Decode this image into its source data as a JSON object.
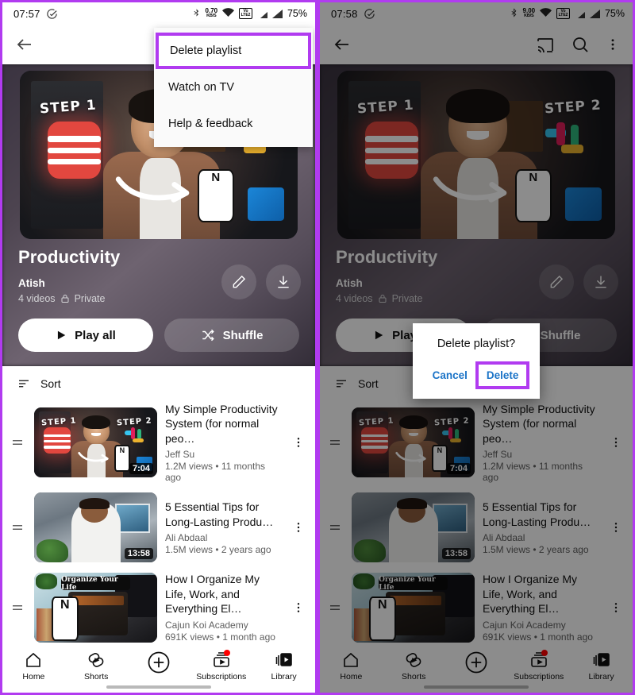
{
  "panels": [
    {
      "id": "left",
      "status_bar": {
        "time": "07:57",
        "check_icon": "check-circle-icon",
        "bluetooth_icon": "bluetooth-icon",
        "data_rate": "0.70",
        "data_unit": "KB/S",
        "wifi_icon": "wifi-icon",
        "volte_label_top": "Vo",
        "volte_label_bottom": "LTE2",
        "signal_icon": "signal-bars-icon",
        "battery": "75%"
      },
      "app_bar": {
        "back_icon": "back-arrow-icon",
        "cast_icon": "cast-icon",
        "search_icon": "search-icon",
        "overflow_icon": "more-vertical-icon"
      },
      "overflow_menu": {
        "visible": true,
        "items": [
          {
            "label": "Delete playlist",
            "highlighted": true
          },
          {
            "label": "Watch on TV",
            "highlighted": false
          },
          {
            "label": "Help & feedback",
            "highlighted": false
          }
        ]
      },
      "dialog": {
        "visible": false
      },
      "dimmed": false
    },
    {
      "id": "right",
      "status_bar": {
        "time": "07:58",
        "check_icon": "check-circle-icon",
        "bluetooth_icon": "bluetooth-icon",
        "data_rate": "9.00",
        "data_unit": "KB/S",
        "wifi_icon": "wifi-icon",
        "volte_label_top": "Vo",
        "volte_label_bottom": "LTE2",
        "signal_icon": "signal-bars-icon",
        "battery": "75%"
      },
      "app_bar": {
        "back_icon": "back-arrow-icon",
        "cast_icon": "cast-icon",
        "search_icon": "search-icon",
        "overflow_icon": "more-vertical-icon"
      },
      "overflow_menu": {
        "visible": false,
        "items": []
      },
      "dialog": {
        "visible": true,
        "title": "Delete playlist?",
        "cancel_label": "Cancel",
        "confirm_label": "Delete",
        "confirm_highlighted": true
      },
      "dimmed": true
    }
  ],
  "playlist": {
    "title": "Productivity",
    "owner": "Atish",
    "video_count": "4 videos",
    "privacy": "Private",
    "privacy_icon": "lock-icon",
    "edit_icon": "pencil-icon",
    "download_icon": "download-icon",
    "play_all_label": "Play all",
    "play_icon": "play-icon",
    "shuffle_label": "Shuffle",
    "shuffle_icon": "shuffle-icon",
    "banner": {
      "step1_text": "STEP 1",
      "step2_text": "STEP 2",
      "notion_glyph": "N"
    }
  },
  "list": {
    "sort_label": "Sort",
    "sort_icon": "sort-icon",
    "drag_icon": "drag-handle-icon",
    "kebab_icon": "more-vertical-icon",
    "videos": [
      {
        "title": "My Simple Productivity System (for normal peo…",
        "channel": "Jeff Su",
        "stats": "1.2M views • 11 months ago",
        "duration": "7:04"
      },
      {
        "title": "5 Essential Tips for Long-Lasting Produ…",
        "channel": "Ali Abdaal",
        "stats": "1.5M views • 2 years ago",
        "duration": "13:58"
      },
      {
        "title": "How I Organize My Life, Work, and Everything El…",
        "channel": "Cajun Koi Academy",
        "stats": "691K views • 1 month ago",
        "duration": "",
        "thumb_caption": "Organize Your Life",
        "thumb_glyph": "N"
      }
    ]
  },
  "bottom_nav": {
    "items": [
      {
        "label": "Home",
        "icon": "home-icon",
        "badge": false
      },
      {
        "label": "Shorts",
        "icon": "shorts-icon",
        "badge": false
      },
      {
        "label": "",
        "icon": "create-plus-icon",
        "badge": false
      },
      {
        "label": "Subscriptions",
        "icon": "subscriptions-icon",
        "badge": true
      },
      {
        "label": "Library",
        "icon": "library-icon",
        "badge": false
      }
    ]
  },
  "colors": {
    "highlight_purple": "#b13bf0",
    "dialog_link": "#1a73c7",
    "badge_red": "#ff0000"
  }
}
